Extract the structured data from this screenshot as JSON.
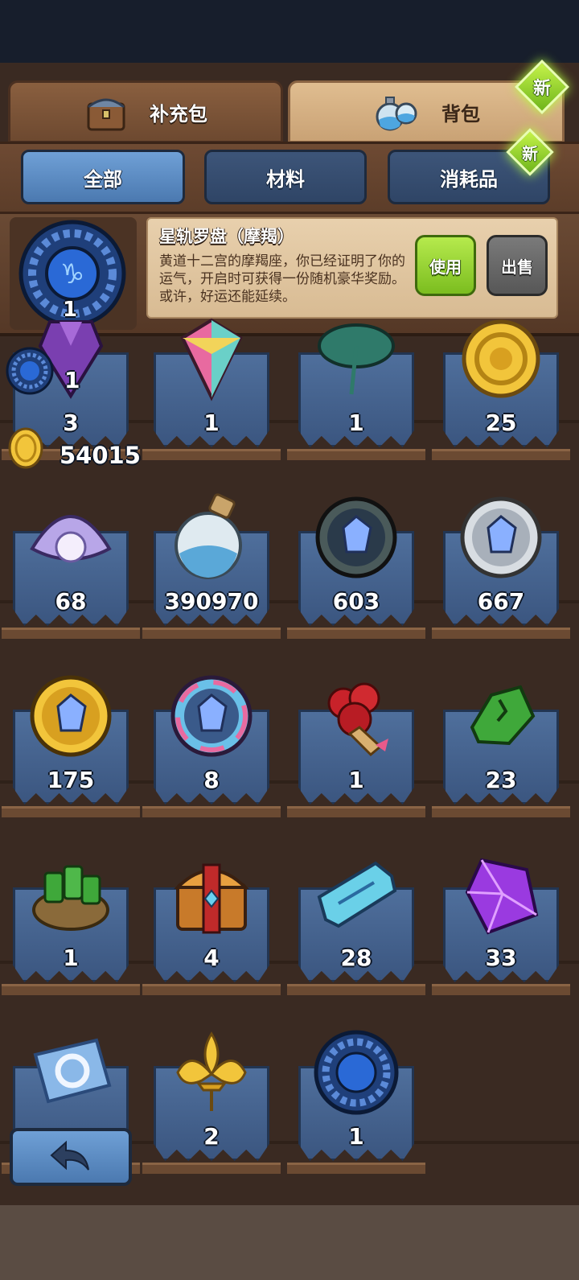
{
  "tabs": {
    "supply": "补充包",
    "bag": "背包",
    "new_badge": "新"
  },
  "subtabs": {
    "all": "全部",
    "materials": "材料",
    "consumables": "消耗品",
    "new_badge": "新"
  },
  "detail": {
    "title": "星轨罗盘（摩羯）",
    "description": "黄道十二宫的摩羯座，你已经证明了你的运气，开启时可获得一份随机豪华奖励。或许，好运还能延续。",
    "icon_count": "1",
    "use_label": "使用",
    "sell_label": "出售"
  },
  "hud": {
    "compass_count": "1",
    "coins": "54015"
  },
  "items": [
    {
      "name": "purple-crystal-icon",
      "count": "3"
    },
    {
      "name": "rainbow-gem-icon",
      "count": "1"
    },
    {
      "name": "lotus-leaf-icon",
      "count": "1"
    },
    {
      "name": "gold-coin-icon",
      "count": "25"
    },
    {
      "name": "pearl-shell-icon",
      "count": "68"
    },
    {
      "name": "sand-bottle-icon",
      "count": "390970"
    },
    {
      "name": "dark-crystal-orb-icon",
      "count": "603"
    },
    {
      "name": "silver-crystal-orb-icon",
      "count": "667"
    },
    {
      "name": "gold-crystal-orb-icon",
      "count": "175"
    },
    {
      "name": "rainbow-crystal-orb-icon",
      "count": "8"
    },
    {
      "name": "rose-bouquet-icon",
      "count": "1"
    },
    {
      "name": "green-ore-icon",
      "count": "23"
    },
    {
      "name": "money-bag-icon",
      "count": "1"
    },
    {
      "name": "treasure-chest-icon",
      "count": "4"
    },
    {
      "name": "ticket-icon",
      "count": "28"
    },
    {
      "name": "purple-prism-icon",
      "count": "33"
    },
    {
      "name": "refresh-ticket-icon",
      "count": ""
    },
    {
      "name": "golden-fleur-icon",
      "count": "2"
    },
    {
      "name": "star-compass-icon",
      "count": "1"
    }
  ],
  "colors": {
    "accent_green": "#8bd12b",
    "tab_blue": "#5a8cc6",
    "wood": "#5c3d29"
  }
}
